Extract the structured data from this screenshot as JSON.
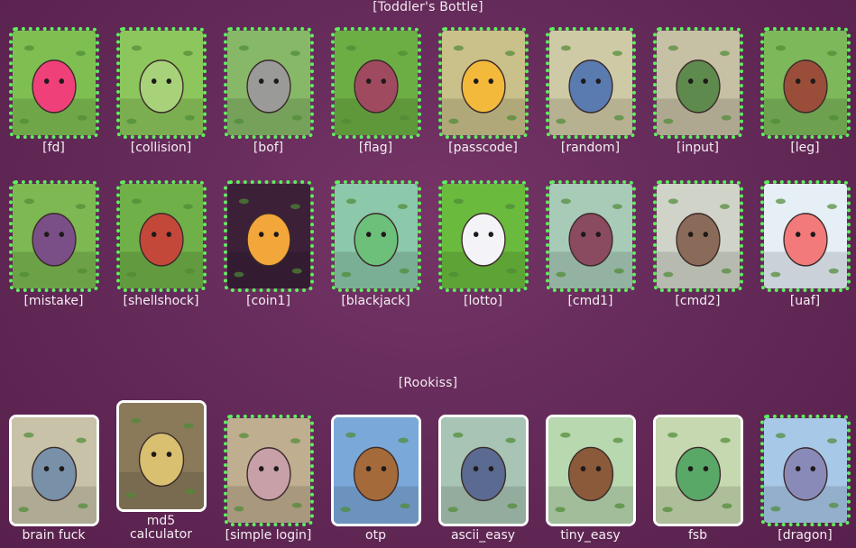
{
  "sections": {
    "toddler": {
      "title": "[Toddler's Bottle]"
    },
    "rookiss": {
      "title": "[Rookiss]"
    }
  },
  "toddler_row1": [
    {
      "label": "[fd]",
      "icon": "pink-slime-icon",
      "bg": "#7fbf52",
      "fg": "#f0407a"
    },
    {
      "label": "[collision]",
      "icon": "caterpillar-icon",
      "bg": "#8dc65c",
      "fg": "#a8d27a"
    },
    {
      "label": "[bof]",
      "icon": "raccoon-icon",
      "bg": "#86b868",
      "fg": "#9a9a98"
    },
    {
      "label": "[flag]",
      "icon": "cocoon-icon",
      "bg": "#6dae44",
      "fg": "#a04a60"
    },
    {
      "label": "[passcode]",
      "icon": "chick-icon",
      "bg": "#c9c08a",
      "fg": "#f2b93a"
    },
    {
      "label": "[random]",
      "icon": "wolf-icon",
      "bg": "#cfcaa6",
      "fg": "#5a7bb0"
    },
    {
      "label": "[input]",
      "icon": "grasshopper-icon",
      "bg": "#c6c0a4",
      "fg": "#5f8a4e"
    },
    {
      "label": "[leg]",
      "icon": "bear-icon",
      "bg": "#7db85a",
      "fg": "#9a4e3a"
    }
  ],
  "toddler_row2": [
    {
      "label": "[mistake]",
      "icon": "monkey-icon",
      "bg": "#7db852",
      "fg": "#7a4e86"
    },
    {
      "label": "[shellshock]",
      "icon": "flytrap-icon",
      "bg": "#70b048",
      "fg": "#c4483a"
    },
    {
      "label": "[coin1]",
      "icon": "pumpkin-ghost-icon",
      "bg": "#3b2038",
      "fg": "#f3a63a"
    },
    {
      "label": "[blackjack]",
      "icon": "lizard-icon",
      "bg": "#8cc8aa",
      "fg": "#6cc07a"
    },
    {
      "label": "[lotto]",
      "icon": "rabbit-icon",
      "bg": "#6aba3e",
      "fg": "#f4f4f8"
    },
    {
      "label": "[cmd1]",
      "icon": "mushroom-girl-icon",
      "bg": "#a8cbb8",
      "fg": "#8a4a60"
    },
    {
      "label": "[cmd2]",
      "icon": "shell-creature-icon",
      "bg": "#d0d4c8",
      "fg": "#8a6a58"
    },
    {
      "label": "[uaf]",
      "icon": "pink-blob-icon",
      "bg": "#e6eef6",
      "fg": "#f27a7a"
    }
  ],
  "rookiss_row": [
    {
      "label": "brain fuck",
      "icon": "zombie-icon",
      "bg": "#c8c2a8",
      "fg": "#7890a8",
      "solid": true
    },
    {
      "label": "md5 calculator",
      "icon": "golden-idol-icon",
      "bg": "#8a7a5a",
      "fg": "#d8c070",
      "solid": true
    },
    {
      "label": "[simple login]",
      "icon": "snail-girl-icon",
      "bg": "#bfae90",
      "fg": "#c8a0a8",
      "solid": false
    },
    {
      "label": "otp",
      "icon": "eyeball-creature-icon",
      "bg": "#7aa8d8",
      "fg": "#a46a3a",
      "solid": true
    },
    {
      "label": "ascii_easy",
      "icon": "knight-girl-icon",
      "bg": "#a8c4b4",
      "fg": "#5a6a90",
      "solid": true
    },
    {
      "label": "tiny_easy",
      "icon": "beetle-icon",
      "bg": "#b8d8b0",
      "fg": "#8a5a3a",
      "solid": true
    },
    {
      "label": "fsb",
      "icon": "snake-icon",
      "bg": "#c6d8b0",
      "fg": "#5aa868",
      "solid": true
    },
    {
      "label": "[dragon]",
      "icon": "dragon-icon",
      "bg": "#a8c8e8",
      "fg": "#8a8ab8",
      "solid": false
    }
  ]
}
